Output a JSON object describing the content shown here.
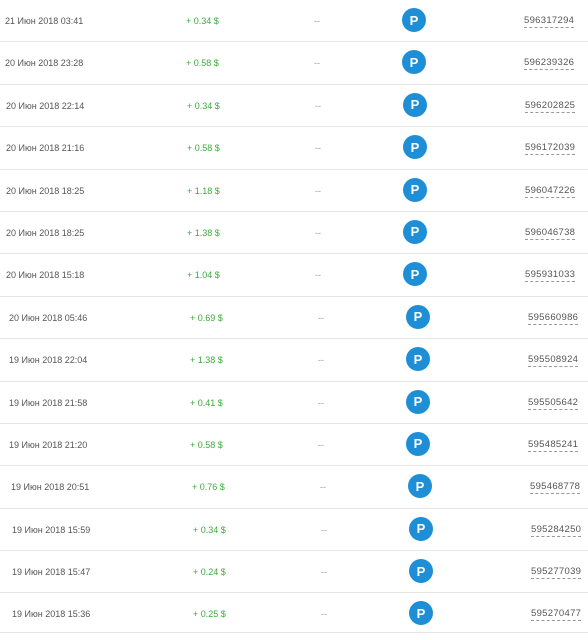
{
  "transactions": [
    {
      "date": "21 Июн 2018 03:41",
      "amount": "+ 0.34 $",
      "status": "--",
      "method": "P",
      "id": "596317294"
    },
    {
      "date": "20 Июн 2018 23:28",
      "amount": "+ 0.58 $",
      "status": "--",
      "method": "P",
      "id": "596239326"
    },
    {
      "date": "20 Июн 2018 22:14",
      "amount": "+ 0.34 $",
      "status": "--",
      "method": "P",
      "id": "596202825"
    },
    {
      "date": "20 Июн 2018 21:16",
      "amount": "+ 0.58 $",
      "status": "--",
      "method": "P",
      "id": "596172039"
    },
    {
      "date": "20 Июн 2018 18:25",
      "amount": "+ 1.18 $",
      "status": "--",
      "method": "P",
      "id": "596047226"
    },
    {
      "date": "20 Июн 2018 18:25",
      "amount": "+ 1.38 $",
      "status": "--",
      "method": "P",
      "id": "596046738"
    },
    {
      "date": "20 Июн 2018 15:18",
      "amount": "+ 1.04 $",
      "status": "--",
      "method": "P",
      "id": "595931033"
    },
    {
      "date": "20 Июн 2018 05:46",
      "amount": "+ 0.69 $",
      "status": "--",
      "method": "P",
      "id": "595660986"
    },
    {
      "date": "19 Июн 2018 22:04",
      "amount": "+ 1.38 $",
      "status": "--",
      "method": "P",
      "id": "595508924"
    },
    {
      "date": "19 Июн 2018 21:58",
      "amount": "+ 0.41 $",
      "status": "--",
      "method": "P",
      "id": "595505642"
    },
    {
      "date": "19 Июн 2018 21:20",
      "amount": "+ 0.58 $",
      "status": "--",
      "method": "P",
      "id": "595485241"
    },
    {
      "date": "19 Июн 2018 20:51",
      "amount": "+ 0.76 $",
      "status": "--",
      "method": "P",
      "id": "595468778"
    },
    {
      "date": "19 Июн 2018 15:59",
      "amount": "+ 0.34 $",
      "status": "--",
      "method": "P",
      "id": "595284250"
    },
    {
      "date": "19 Июн 2018 15:47",
      "amount": "+ 0.24 $",
      "status": "--",
      "method": "P",
      "id": "595277039"
    },
    {
      "date": "19 Июн 2018 15:36",
      "amount": "+ 0.25 $",
      "status": "--",
      "method": "P",
      "id": "595270477"
    }
  ],
  "colors": {
    "amount": "#3aaa3a",
    "method_icon": "#1e8fd6",
    "row_border": "#e6e6e6"
  },
  "icons": {
    "method": "payeer-p-icon"
  }
}
